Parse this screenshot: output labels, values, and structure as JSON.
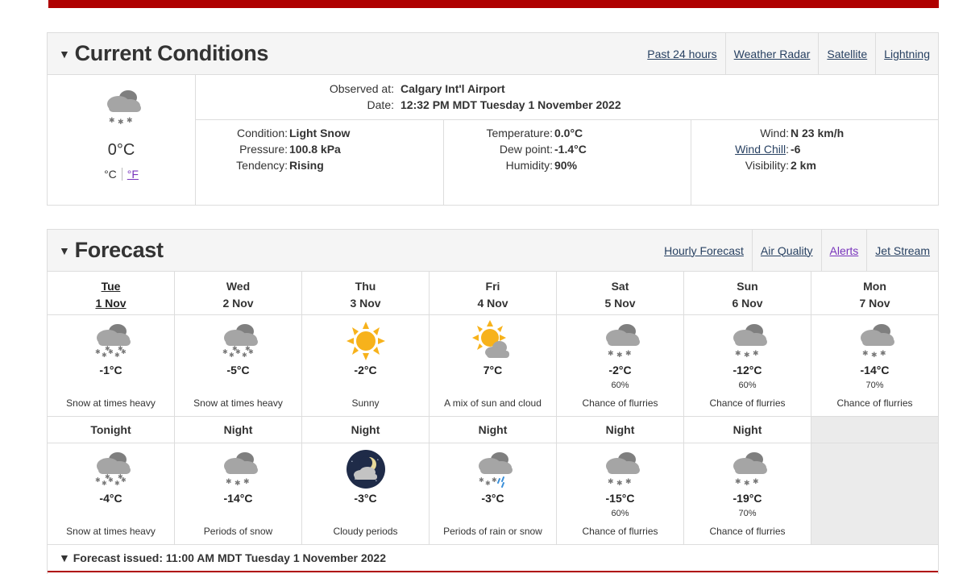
{
  "current": {
    "title": "Current Conditions",
    "links": [
      "Past 24 hours",
      "Weather Radar",
      "Satellite",
      "Lightning"
    ],
    "icon": "light-snow-icon",
    "temp": "0°C",
    "unit_c": "°C",
    "unit_f": "°F",
    "observed_label": "Observed at:",
    "observed_value": "Calgary Int'l Airport",
    "date_label": "Date:",
    "date_value": "12:32 PM MDT Tuesday 1 November 2022",
    "condition_label": "Condition:",
    "condition": "Light Snow",
    "pressure_label": "Pressure:",
    "pressure": "100.8 kPa",
    "tendency_label": "Tendency:",
    "tendency": "Rising",
    "temperature_label": "Temperature:",
    "temperature": "0.0°C",
    "dewpoint_label": "Dew point:",
    "dewpoint": "-1.4°C",
    "humidity_label": "Humidity:",
    "humidity": "90%",
    "wind_label": "Wind:",
    "wind": "N 23 km/h",
    "windchill_label": "Wind Chill",
    "windchill": "-6",
    "visibility_label": "Visibility:",
    "visibility": "2 km"
  },
  "forecast": {
    "title": "Forecast",
    "links": [
      "Hourly Forecast",
      "Air Quality",
      "Alerts",
      "Jet Stream"
    ],
    "days": [
      {
        "day": "Tue",
        "date": "1 Nov",
        "icon": "heavy-snow-icon",
        "temp": "-1°C",
        "pop": "",
        "summary": "Snow at times heavy"
      },
      {
        "day": "Wed",
        "date": "2 Nov",
        "icon": "heavy-snow-icon",
        "temp": "-5°C",
        "pop": "",
        "summary": "Snow at times heavy"
      },
      {
        "day": "Thu",
        "date": "3 Nov",
        "icon": "sun-icon",
        "temp": "-2°C",
        "pop": "",
        "summary": "Sunny"
      },
      {
        "day": "Fri",
        "date": "4 Nov",
        "icon": "sun-cloud-icon",
        "temp": "7°C",
        "pop": "",
        "summary": "A mix of sun and cloud"
      },
      {
        "day": "Sat",
        "date": "5 Nov",
        "icon": "flurries-icon",
        "temp": "-2°C",
        "pop": "60%",
        "summary": "Chance of flurries"
      },
      {
        "day": "Sun",
        "date": "6 Nov",
        "icon": "flurries-icon",
        "temp": "-12°C",
        "pop": "60%",
        "summary": "Chance of flurries"
      },
      {
        "day": "Mon",
        "date": "7 Nov",
        "icon": "flurries-icon",
        "temp": "-14°C",
        "pop": "70%",
        "summary": "Chance of flurries"
      }
    ],
    "nights": [
      {
        "label": "Tonight",
        "icon": "heavy-snow-icon",
        "temp": "-4°C",
        "pop": "",
        "summary": "Snow at times heavy"
      },
      {
        "label": "Night",
        "icon": "flurries-icon",
        "temp": "-14°C",
        "pop": "",
        "summary": "Periods of snow"
      },
      {
        "label": "Night",
        "icon": "cloudy-night-icon",
        "temp": "-3°C",
        "pop": "",
        "summary": "Cloudy periods"
      },
      {
        "label": "Night",
        "icon": "rain-snow-icon",
        "temp": "-3°C",
        "pop": "",
        "summary": "Periods of rain or snow"
      },
      {
        "label": "Night",
        "icon": "flurries-icon",
        "temp": "-15°C",
        "pop": "60%",
        "summary": "Chance of flurries"
      },
      {
        "label": "Night",
        "icon": "flurries-icon",
        "temp": "-19°C",
        "pop": "70%",
        "summary": "Chance of flurries"
      }
    ],
    "issued": "▼ Forecast issued: 11:00 AM MDT Tuesday 1 November 2022"
  },
  "colors": {
    "accent_red": "#af0000",
    "link": "#284162",
    "visited": "#7834bc",
    "sun": "#f7b21b",
    "cloud": "#9a9a9a"
  }
}
